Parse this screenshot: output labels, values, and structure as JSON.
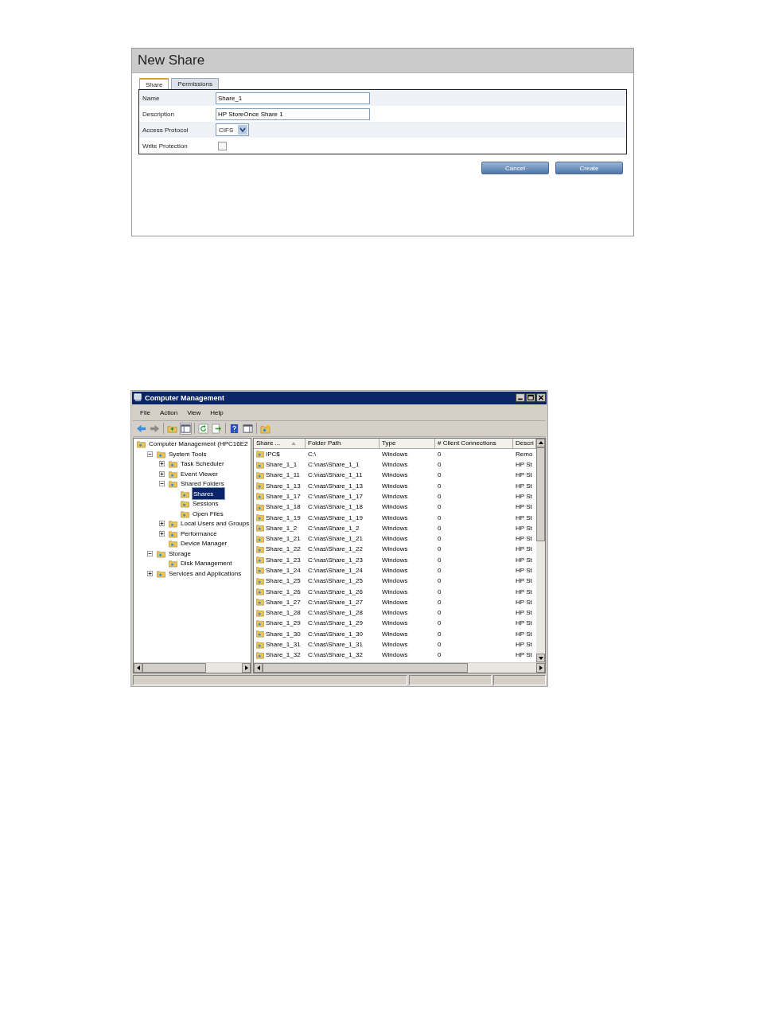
{
  "new_share": {
    "title": "New Share",
    "tabs": [
      {
        "label": "Share",
        "selected": true
      },
      {
        "label": "Permissions",
        "selected": false
      }
    ],
    "fields": [
      {
        "kind": "text",
        "label": "Name",
        "value": "Share_1"
      },
      {
        "kind": "text",
        "label": "Description",
        "value": "HP StoreOnce Share 1"
      },
      {
        "kind": "select",
        "label": "Access Protocol",
        "value": "CIFS"
      },
      {
        "kind": "checkbox",
        "label": "Write Protection",
        "checked": false
      }
    ],
    "buttons": [
      "Cancel",
      "Create"
    ]
  },
  "computer_management": {
    "window": {
      "title": "Computer Management"
    },
    "menu": [
      "File",
      "Action",
      "View",
      "Help"
    ],
    "tree": [
      {
        "label": "Computer Management (HPC16E2",
        "selected": false,
        "children": [
          {
            "label": "System Tools",
            "selected": false,
            "expanded": true,
            "children": [
              {
                "label": "Task Scheduler",
                "selected": false,
                "expanded": false
              },
              {
                "label": "Event Viewer",
                "selected": false,
                "expanded": false
              },
              {
                "label": "Shared Folders",
                "selected": false,
                "expanded": true,
                "children": [
                  {
                    "label": "Shares",
                    "selected": true
                  },
                  {
                    "label": "Sessions",
                    "selected": false
                  },
                  {
                    "label": "Open Files",
                    "selected": false
                  }
                ]
              },
              {
                "label": "Local Users and Groups",
                "selected": false,
                "expanded": false
              },
              {
                "label": "Performance",
                "selected": false,
                "expanded": false
              },
              {
                "label": "Device Manager",
                "selected": false
              }
            ]
          },
          {
            "label": "Storage",
            "selected": false,
            "expanded": true,
            "children": [
              {
                "label": "Disk Management",
                "selected": false
              }
            ]
          },
          {
            "label": "Services and Applications",
            "selected": false,
            "expanded": false
          }
        ]
      }
    ],
    "table": {
      "columns": [
        "Share ...",
        "Folder Path",
        "Type",
        "# Client Connections",
        "Descri"
      ],
      "rows": [
        [
          "IPC$",
          "C:\\",
          "Windows",
          "0",
          "Remo"
        ],
        [
          "Share_1_1",
          "C:\\nas\\Share_1_1",
          "Windows",
          "0",
          "HP St"
        ],
        [
          "Share_1_11",
          "C:\\nas\\Share_1_11",
          "Windows",
          "0",
          "HP St"
        ],
        [
          "Share_1_13",
          "C:\\nas\\Share_1_13",
          "Windows",
          "0",
          "HP St"
        ],
        [
          "Share_1_17",
          "C:\\nas\\Share_1_17",
          "Windows",
          "0",
          "HP St"
        ],
        [
          "Share_1_18",
          "C:\\nas\\Share_1_18",
          "Windows",
          "0",
          "HP St"
        ],
        [
          "Share_1_19",
          "C:\\nas\\Share_1_19",
          "Windows",
          "0",
          "HP St"
        ],
        [
          "Share_1_2",
          "C:\\nas\\Share_1_2",
          "Windows",
          "0",
          "HP St"
        ],
        [
          "Share_1_21",
          "C:\\nas\\Share_1_21",
          "Windows",
          "0",
          "HP St"
        ],
        [
          "Share_1_22",
          "C:\\nas\\Share_1_22",
          "Windows",
          "0",
          "HP St"
        ],
        [
          "Share_1_23",
          "C:\\nas\\Share_1_23",
          "Windows",
          "0",
          "HP St"
        ],
        [
          "Share_1_24",
          "C:\\nas\\Share_1_24",
          "Windows",
          "0",
          "HP St"
        ],
        [
          "Share_1_25",
          "C:\\nas\\Share_1_25",
          "Windows",
          "0",
          "HP St"
        ],
        [
          "Share_1_26",
          "C:\\nas\\Share_1_26",
          "Windows",
          "0",
          "HP St"
        ],
        [
          "Share_1_27",
          "C:\\nas\\Share_1_27",
          "Windows",
          "0",
          "HP St"
        ],
        [
          "Share_1_28",
          "C:\\nas\\Share_1_28",
          "Windows",
          "0",
          "HP St"
        ],
        [
          "Share_1_29",
          "C:\\nas\\Share_1_29",
          "Windows",
          "0",
          "HP St"
        ],
        [
          "Share_1_30",
          "C:\\nas\\Share_1_30",
          "Windows",
          "0",
          "HP St"
        ],
        [
          "Share_1_31",
          "C:\\nas\\Share_1_31",
          "Windows",
          "0",
          "HP St"
        ],
        [
          "Share_1_32",
          "C:\\nas\\Share_1_32",
          "Windows",
          "0",
          "HP St"
        ]
      ]
    }
  }
}
